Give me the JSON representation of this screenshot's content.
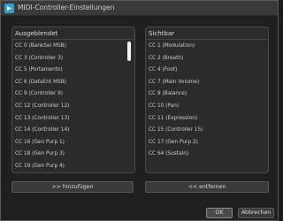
{
  "window": {
    "title": "MIDI-Controller-Einstellungen"
  },
  "left_panel": {
    "header": "Ausgeblendet",
    "items": [
      "CC 0  (BankSel MSB)",
      "CC 3  (Controller 3)",
      "CC 5  (Portamento)",
      "CC 6  (DataEnt MSB)",
      "CC 9  (Controller 9)",
      "CC 12  (Controller 12)",
      "CC 13  (Controller 13)",
      "CC 14  (Controller 14)",
      "CC 16  (Gen Purp 1)",
      "CC 18  (Gen Purp 3)",
      "CC 19  (Gen Purp 4)"
    ]
  },
  "right_panel": {
    "header": "Sichtbar",
    "items": [
      "CC 1  (Modulation)",
      "CC 2  (Breath)",
      "CC 4  (Foot)",
      "CC 7  (Main Volume)",
      "CC 8  (Balance)",
      "CC 10  (Pan)",
      "CC 11  (Expression)",
      "CC 15  (Controller 15)",
      "CC 17  (Gen Purp 2)",
      "CC 64  (Sustain)"
    ]
  },
  "buttons": {
    "add": ">> hinzufügen",
    "remove": "<< entfernen",
    "ok": "OK",
    "cancel": "Abbrechen"
  },
  "colors": {
    "background": "#1f1f1f",
    "panel": "#2b2b2b",
    "accent": "#2ea3c7"
  }
}
